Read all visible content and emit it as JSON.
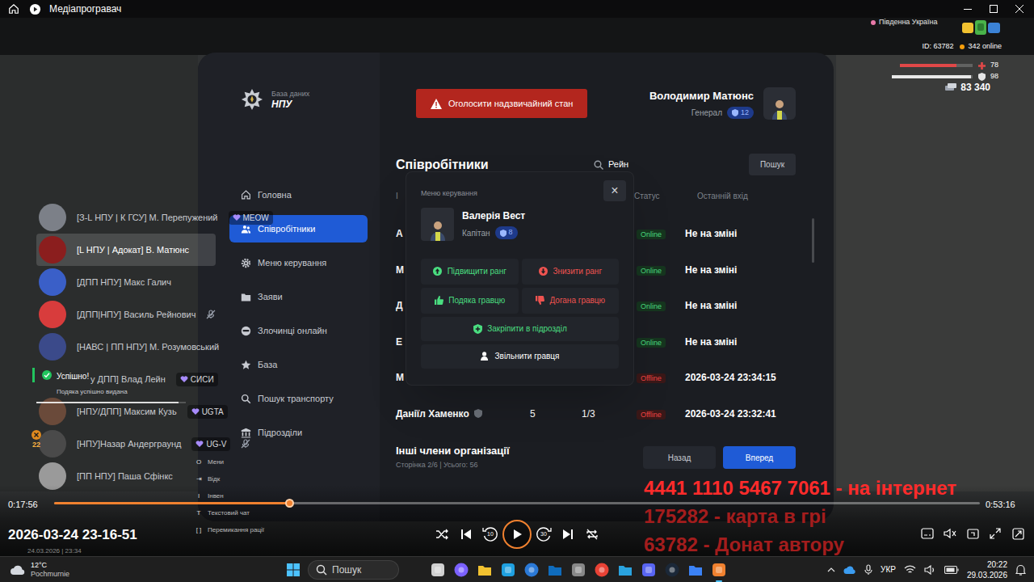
{
  "window": {
    "title": "Медіапрогравач"
  },
  "hud": {
    "region": "Південна Україна",
    "player_id": "ID: 63782",
    "online": "342 online",
    "health": {
      "value": "78",
      "level": 0.78
    },
    "armor": {
      "value": "98",
      "level": 0.98
    },
    "money": "83 340"
  },
  "database": {
    "subtitle": "База даних",
    "title": "НПУ",
    "nav": [
      {
        "label": "Головна",
        "selected": false
      },
      {
        "label": "Співробітники",
        "selected": true
      },
      {
        "label": "Меню керування",
        "selected": false
      },
      {
        "label": "Заяви",
        "selected": false
      },
      {
        "label": "Злочинці онлайн",
        "selected": false
      },
      {
        "label": "База",
        "selected": false
      },
      {
        "label": "Пошук транспорту",
        "selected": false
      },
      {
        "label": "Підрозділи",
        "selected": false
      }
    ],
    "emergency_button": "Оголосити надзвичайний стан",
    "user": {
      "name": "Володимир Матюнс",
      "rank": "Генерал",
      "level": "12"
    },
    "heading": "Співробітники",
    "search": {
      "value": "Рейн",
      "button": "Пошук"
    },
    "columns": [
      "І",
      "Статус",
      "Останній вхід"
    ],
    "rows": [
      {
        "name": "А",
        "verified": false,
        "status": "Online",
        "online": true,
        "last_seen": "Не на зміні"
      },
      {
        "name": "М",
        "verified": false,
        "status": "Online",
        "online": true,
        "last_seen": "Не на зміні"
      },
      {
        "name": "Д",
        "verified": false,
        "status": "Online",
        "online": true,
        "last_seen": "Не на зміні"
      },
      {
        "name": "Е",
        "verified": false,
        "status": "Online",
        "online": true,
        "last_seen": "Не на зміні"
      },
      {
        "name": "М",
        "verified": false,
        "status": "Offline",
        "online": false,
        "last_seen": "2026-03-24 23:34:15"
      },
      {
        "name": "Даніїл Хаменко",
        "verified": true,
        "rank": "5",
        "warnings": "1/3",
        "status": "Offline",
        "online": false,
        "last_seen": "2026-03-24 23:32:41"
      }
    ],
    "section_title": "Інші члени організації",
    "pagination": "Сторінка 2/6 | Усього: 56",
    "prev_button": "Назад",
    "next_button": "Вперед"
  },
  "modal": {
    "title": "Меню керування",
    "close": "×",
    "name": "Валерія Вест",
    "rank": "Капітан",
    "level": "8",
    "actions": [
      {
        "label": "Підвищити ранг",
        "color": "#4ade80",
        "kind": "half"
      },
      {
        "label": "Знизити ранг",
        "color": "#ef5350",
        "kind": "half"
      },
      {
        "label": "Подяка гравцю",
        "color": "#4ade80",
        "kind": "half"
      },
      {
        "label": "Догана гравцю",
        "color": "#ef5350",
        "kind": "half"
      },
      {
        "label": "Закріпити в підрозділ",
        "color": "#4ade80",
        "kind": "wide"
      },
      {
        "label": "Звільнити гравця",
        "color": "#ffffff",
        "kind": "wide"
      }
    ]
  },
  "voice": [
    {
      "name": "[З-L НПУ | К ГСУ] М. Перепужений",
      "tag": "MEOW",
      "highlighted": false,
      "muted": false,
      "obscured": false,
      "color": "#7c8088"
    },
    {
      "name": "[L НПУ | Адокат] В. Матюнс",
      "highlighted": true,
      "muted": false,
      "obscured": false,
      "color": "#8b1e1e"
    },
    {
      "name": "[ДПП НПУ] Макс Галич",
      "highlighted": false,
      "muted": false,
      "obscured": false,
      "color": "#3a5fc8"
    },
    {
      "name": "[ДПП|НПУ] Василь Рейнович",
      "highlighted": false,
      "muted": true,
      "obscured": false,
      "color": "#d83c3c"
    },
    {
      "name": "[НАВС | ПП НПУ] М. Розумовський",
      "highlighted": false,
      "muted": false,
      "obscured": false,
      "color": "#3b4a8a"
    },
    {
      "name": "у ДПП] Влад Лейн",
      "tag": "СИСИ",
      "highlighted": false,
      "muted": false,
      "obscured": true,
      "color": "#8a7a5a"
    },
    {
      "name": "[НПУ/ДПП] Максим Кузь",
      "tag": "UGTA",
      "highlighted": false,
      "muted": false,
      "obscured": false,
      "color": "#6a4a3a"
    },
    {
      "name": "[НПУ]Назар Андерграунд",
      "tag": "UG-V",
      "badge": "22",
      "highlighted": false,
      "muted": true,
      "obscured": false,
      "color": "#4a4a4a"
    },
    {
      "name": "[ПП НПУ] Паша Сфінкс",
      "highlighted": false,
      "muted": false,
      "obscured": false,
      "color": "#9a9a9a"
    }
  ],
  "toast": {
    "title": "Успішно!",
    "message": "Подяка успішно видана",
    "level": 0.95
  },
  "key_hints": [
    {
      "key": "O",
      "label": "Мени"
    },
    {
      "key": "⇥",
      "label": "Відк"
    },
    {
      "key": "I",
      "label": "Інвен"
    },
    {
      "key": "T",
      "label": "Текстовий чат"
    },
    {
      "key": "[ ]",
      "label": "Перемикання рації"
    }
  ],
  "recorded_at": "24.03.2026 | 23:34",
  "overlay_text": [
    {
      "text": "4441 1110 5467 7061 - на інтернет",
      "faded": false
    },
    {
      "text": "175282 - карта в грі",
      "faded": true
    },
    {
      "text": "63782 - Донат автору",
      "faded": true
    }
  ],
  "player": {
    "elapsed": "0:17:56",
    "duration": "0:53:16",
    "level": 0.254,
    "title": "2026-03-24 23-16-51",
    "skip_back": "10",
    "skip_forward": "30",
    "playing": false
  },
  "taskbar": {
    "temperature": "12°C",
    "weather": "Pochmurnie",
    "search": "Пошук",
    "language": "УКР",
    "time": "20:22",
    "date": "29.03.2026"
  }
}
